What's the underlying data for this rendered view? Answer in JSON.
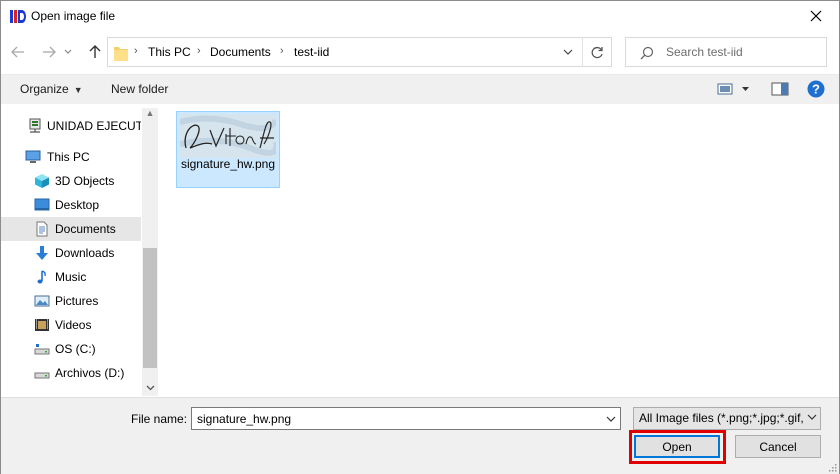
{
  "window": {
    "title": "Open image file"
  },
  "nav": {
    "breadcrumbs": [
      "This PC",
      "Documents",
      "test-iid"
    ],
    "search_placeholder": "Search test-iid"
  },
  "toolbar": {
    "organize": "Organize",
    "new_folder": "New folder"
  },
  "sidebar": {
    "items": [
      {
        "label": "UNIDAD EJECUTO",
        "icon": "network-drive-icon"
      },
      {
        "label": "This PC",
        "icon": "computer-icon"
      },
      {
        "label": "3D Objects",
        "icon": "cube-icon"
      },
      {
        "label": "Desktop",
        "icon": "desktop-icon"
      },
      {
        "label": "Documents",
        "icon": "document-icon",
        "selected": true
      },
      {
        "label": "Downloads",
        "icon": "download-arrow-icon"
      },
      {
        "label": "Music",
        "icon": "music-note-icon"
      },
      {
        "label": "Pictures",
        "icon": "picture-icon"
      },
      {
        "label": "Videos",
        "icon": "film-icon"
      },
      {
        "label": "OS (C:)",
        "icon": "drive-icon"
      },
      {
        "label": "Archivos (D:)",
        "icon": "drive-icon"
      }
    ]
  },
  "files": [
    {
      "name": "signature_hw.png",
      "thumbnail_text": "LVitonA",
      "selected": true
    }
  ],
  "bottom": {
    "file_name_label": "File name:",
    "file_name_value": "signature_hw.png",
    "filter": "All Image files (*.png;*.jpg;*.gif,",
    "open_label": "Open",
    "cancel_label": "Cancel"
  },
  "colors": {
    "selection": "#cce8ff",
    "highlight_box": "#e00000",
    "accent": "#0078d7"
  }
}
